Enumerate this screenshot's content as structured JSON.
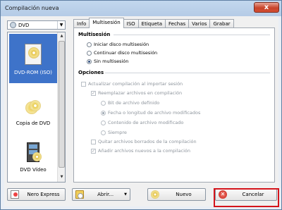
{
  "window": {
    "title": "Compilación nueva",
    "close_glyph": "x"
  },
  "left": {
    "type_select_value": "DVD",
    "types": [
      {
        "label": "DVD-ROM (ISO)",
        "icon": "dvd-rom-icon",
        "selected": true
      },
      {
        "label": "Copia de DVD",
        "icon": "dvd-copy-icon",
        "selected": false
      },
      {
        "label": "DVD Vídeo",
        "icon": "dvd-video-icon",
        "selected": false
      },
      {
        "label": "",
        "icon": "dvd-item-icon",
        "selected": false
      }
    ]
  },
  "tabs": [
    "Info",
    "Multisesión",
    "ISO",
    "Etiqueta",
    "Fechas",
    "Varios",
    "Grabar"
  ],
  "active_tab": "Multisesión",
  "panel": {
    "multisession_title": "Multisesión",
    "radio_start": "Iniciar disco multisesión",
    "radio_continue": "Continuar disco multisesión",
    "radio_none": "Sin multisesión",
    "selected_radio": "Sin multisesión",
    "options_title": "Opciones",
    "check_update": "Actualizar compilación al importar sesión",
    "check_replace": "Reemplazar archivos en compilación",
    "radio_bit": "Bit de archivo definido",
    "radio_date": "Fecha o longitud de archivo modificados",
    "radio_content": "Contenido de archivo modificado",
    "radio_always": "Siempre",
    "check_remove": "Quitar archivos borrados de la compilación",
    "check_add": "Añadir archivos nuevos a la compilación"
  },
  "buttons": {
    "nero_express": "Nero Express",
    "open": "Abrir...",
    "new": "Nuevo",
    "cancel": "Cancelar"
  },
  "colors": {
    "highlight": "#d4141b",
    "selected_item": "#3e73c9"
  }
}
